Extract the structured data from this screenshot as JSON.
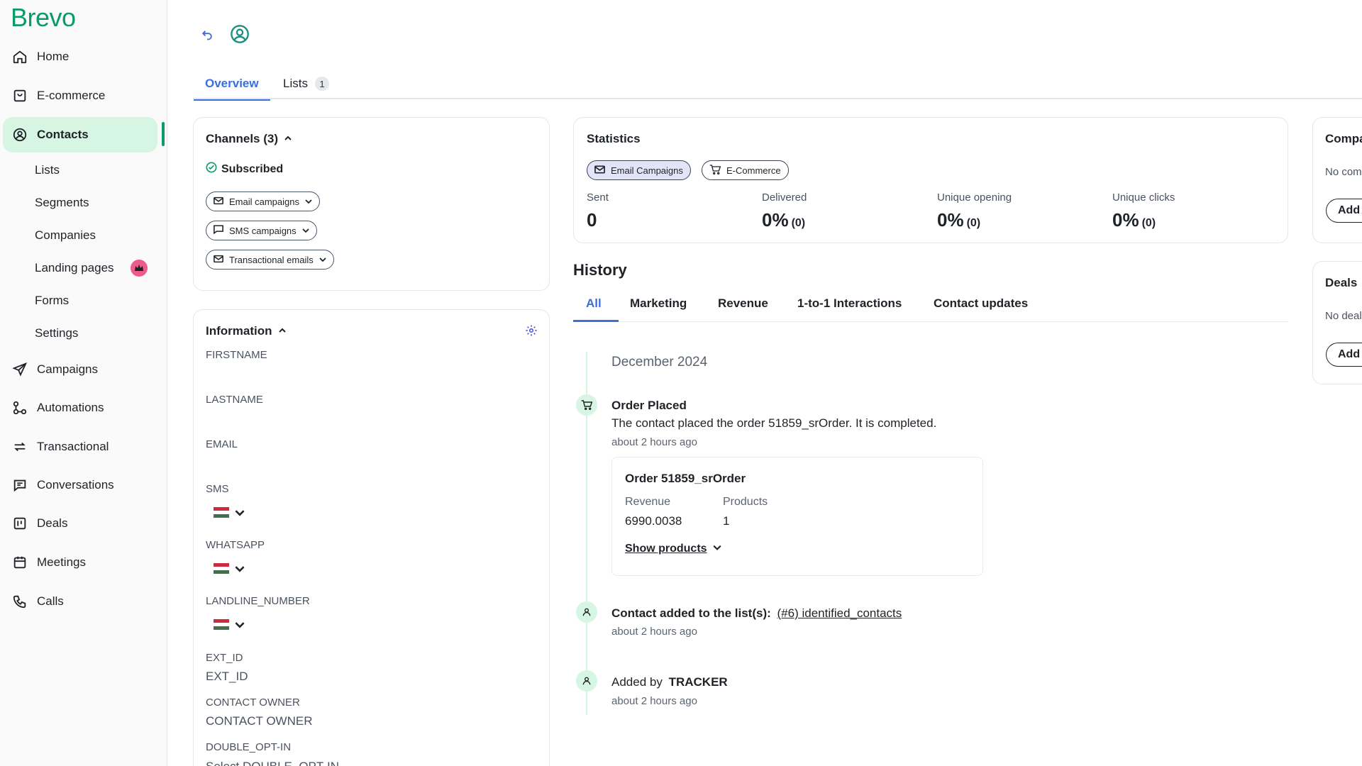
{
  "brand": {
    "logo_text": "Brevo",
    "accent_color": "#0b996e",
    "link_color": "#3a6fd8"
  },
  "sidebar": {
    "items": [
      {
        "label": "Home",
        "icon": "home-icon"
      },
      {
        "label": "E-commerce",
        "icon": "shopping-bag-icon"
      },
      {
        "label": "Contacts",
        "icon": "user-circle-icon",
        "active": true
      },
      {
        "label": "Campaigns",
        "icon": "send-icon"
      },
      {
        "label": "Automations",
        "icon": "automation-icon"
      },
      {
        "label": "Transactional",
        "icon": "repeat-icon"
      },
      {
        "label": "Conversations",
        "icon": "chat-icon"
      },
      {
        "label": "Deals",
        "icon": "deals-icon"
      },
      {
        "label": "Meetings",
        "icon": "calendar-icon"
      },
      {
        "label": "Calls",
        "icon": "phone-icon"
      }
    ],
    "contacts_sub": [
      "Lists",
      "Segments",
      "Companies",
      "Landing pages",
      "Forms",
      "Settings"
    ]
  },
  "tabs": {
    "overview": "Overview",
    "lists": "Lists",
    "lists_count": "1"
  },
  "channels": {
    "title": "Channels (3)",
    "status": "Subscribed",
    "pills": [
      "Email campaigns",
      "SMS campaigns",
      "Transactional emails"
    ]
  },
  "information": {
    "title": "Information",
    "fields": {
      "firstname": "FIRSTNAME",
      "lastname": "LASTNAME",
      "email": "EMAIL",
      "sms": "SMS",
      "whatsapp": "WHATSAPP",
      "landline": "LANDLINE_NUMBER",
      "ext_id_label": "EXT_ID",
      "ext_id_value": "EXT_ID",
      "owner_label": "CONTACT OWNER",
      "owner_value": "CONTACT OWNER",
      "double_opt_in_label": "DOUBLE_OPT-IN",
      "double_opt_in_value": "Select DOUBLE_OPT-IN"
    }
  },
  "statistics": {
    "title": "Statistics",
    "pills": [
      "Email Campaigns",
      "E-Commerce"
    ],
    "stats": [
      {
        "label": "Sent",
        "value": "0",
        "sub": ""
      },
      {
        "label": "Delivered",
        "value": "0%",
        "sub": "(0)"
      },
      {
        "label": "Unique opening",
        "value": "0%",
        "sub": "(0)"
      },
      {
        "label": "Unique clicks",
        "value": "0%",
        "sub": "(0)"
      }
    ]
  },
  "history": {
    "title": "History",
    "tabs": [
      "All",
      "Marketing",
      "Revenue",
      "1-to-1 Interactions",
      "Contact updates"
    ],
    "month": "December 2024",
    "events": {
      "order_title": "Order Placed",
      "order_desc": "The contact placed the order 51859_srOrder. It is completed.",
      "order_time": "about 2 hours ago",
      "order_card_title": "Order 51859_srOrder",
      "revenue_label": "Revenue",
      "revenue_value": "6990.0038",
      "products_label": "Products",
      "products_value": "1",
      "show_products": "Show products",
      "list_prefix": "Contact added to the list(s):",
      "list_link": "(#6) identified_contacts",
      "list_time": "about 2 hours ago",
      "added_prefix": "Added by",
      "added_by": "TRACKER",
      "added_time": "about 2 hours ago"
    }
  },
  "right_panel": {
    "companies_title": "Compa",
    "companies_empty": "No com",
    "companies_add": "Add c",
    "deals_title": "Deals",
    "deals_empty": "No deal",
    "deals_add": "Add c"
  }
}
